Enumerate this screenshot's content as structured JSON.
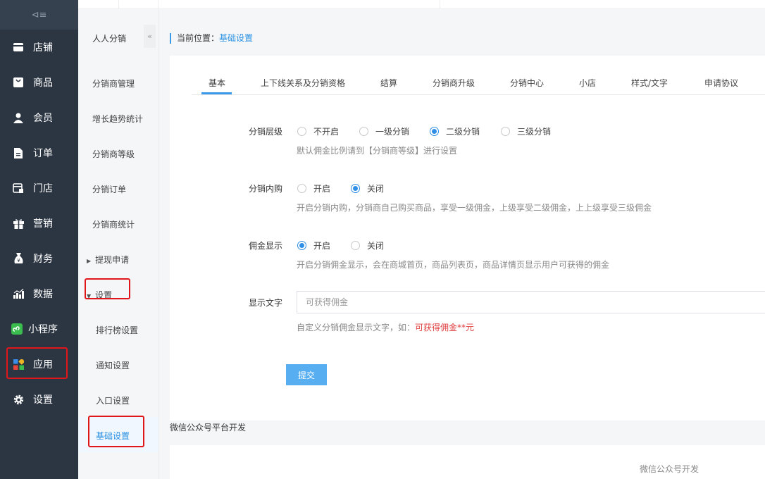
{
  "sidebar": {
    "collapse_glyph": "⊲≡",
    "items": [
      {
        "label": "店铺",
        "icon": "store-icon"
      },
      {
        "label": "商品",
        "icon": "goods-icon"
      },
      {
        "label": "会员",
        "icon": "member-icon"
      },
      {
        "label": "订单",
        "icon": "order-icon"
      },
      {
        "label": "门店",
        "icon": "shop-icon"
      },
      {
        "label": "营销",
        "icon": "gift-icon"
      },
      {
        "label": "财务",
        "icon": "finance-icon"
      },
      {
        "label": "数据",
        "icon": "chart-icon"
      },
      {
        "label": "小程序",
        "icon": "miniapp-icon"
      },
      {
        "label": "应用",
        "icon": "apps-icon"
      },
      {
        "label": "设置",
        "icon": "gear-icon"
      }
    ]
  },
  "subnav": {
    "title": "人人分销",
    "collapse_glyph": "«",
    "items": [
      {
        "label": "分销商管理"
      },
      {
        "label": "增长趋势统计"
      },
      {
        "label": "分销商等级"
      },
      {
        "label": "分销订单"
      },
      {
        "label": "分销商统计"
      },
      {
        "label": "提现申请"
      },
      {
        "label": "设置"
      },
      {
        "label": "排行榜设置"
      },
      {
        "label": "通知设置"
      },
      {
        "label": "入口设置"
      },
      {
        "label": "基础设置"
      }
    ]
  },
  "breadcrumb": {
    "prefix": "当前位置：",
    "current": "基础设置"
  },
  "tabs": [
    "基本",
    "上下线关系及分销资格",
    "结算",
    "分销商升级",
    "分销中心",
    "小店",
    "样式/文字",
    "申请协议"
  ],
  "form": {
    "level": {
      "label": "分销层级",
      "options": [
        "不开启",
        "一级分销",
        "二级分销",
        "三级分销"
      ],
      "selected": "二级分销",
      "help": "默认佣金比例请到【分销商等级】进行设置"
    },
    "self_buy": {
      "label": "分销内购",
      "options": [
        "开启",
        "关闭"
      ],
      "selected": "关闭",
      "help": "开启分销内购，分销商自己购买商品，享受一级佣金，上级享受二级佣金，上上级享受三级佣金"
    },
    "commission_display": {
      "label": "佣金显示",
      "options": [
        "开启",
        "关闭"
      ],
      "selected": "开启",
      "help": "开启分销佣金显示，会在商城首页，商品列表页，商品详情页显示用户可获得的佣金"
    },
    "display_text": {
      "label": "显示文字",
      "placeholder": "可获得佣金",
      "help_prefix": "自定义分销佣金显示文字，如：",
      "help_example": "可获得佣金**元"
    },
    "submit": "提交"
  },
  "footer": {
    "title": "微信公众号平台开发",
    "note": "微信公众号开发"
  },
  "colors": {
    "accent": "#2b91e2",
    "sidebar_bg": "#2c3643",
    "highlight_box": "#e0161b"
  }
}
